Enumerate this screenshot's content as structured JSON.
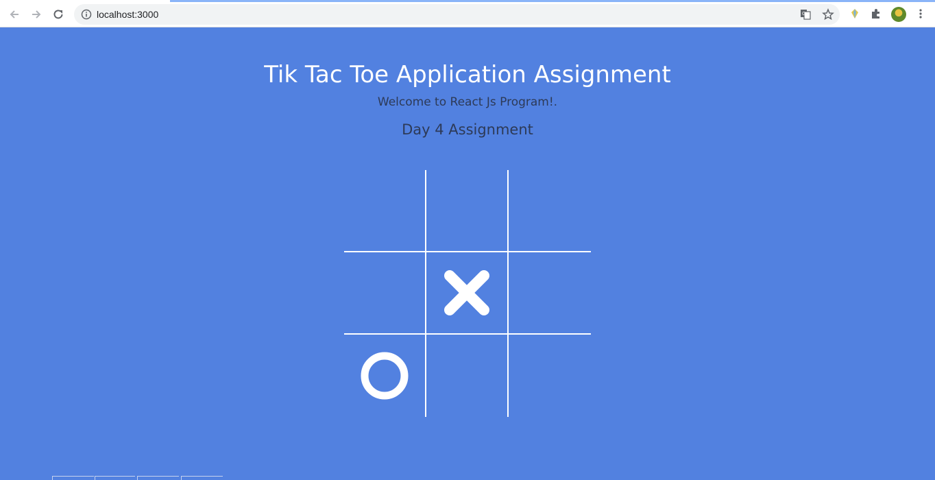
{
  "browser": {
    "url": "localhost:3000",
    "icons": [
      "back-arrow-icon",
      "forward-arrow-icon",
      "reload-icon",
      "info-icon",
      "translate-icon",
      "star-icon",
      "extension-gem-icon",
      "puzzle-icon",
      "avatar",
      "kebab-menu-icon"
    ]
  },
  "page": {
    "title": "Tik Tac Toe Application Assignment",
    "subtitle": "Welcome to React Js Program!.",
    "day": "Day 4 Assignment"
  },
  "board": {
    "cells": [
      "",
      "",
      "",
      "",
      "X",
      "",
      "O",
      "",
      ""
    ]
  },
  "colors": {
    "background": "#5281e0",
    "grid_line": "#ffffff",
    "subtitle_text": "#2d3a57"
  }
}
